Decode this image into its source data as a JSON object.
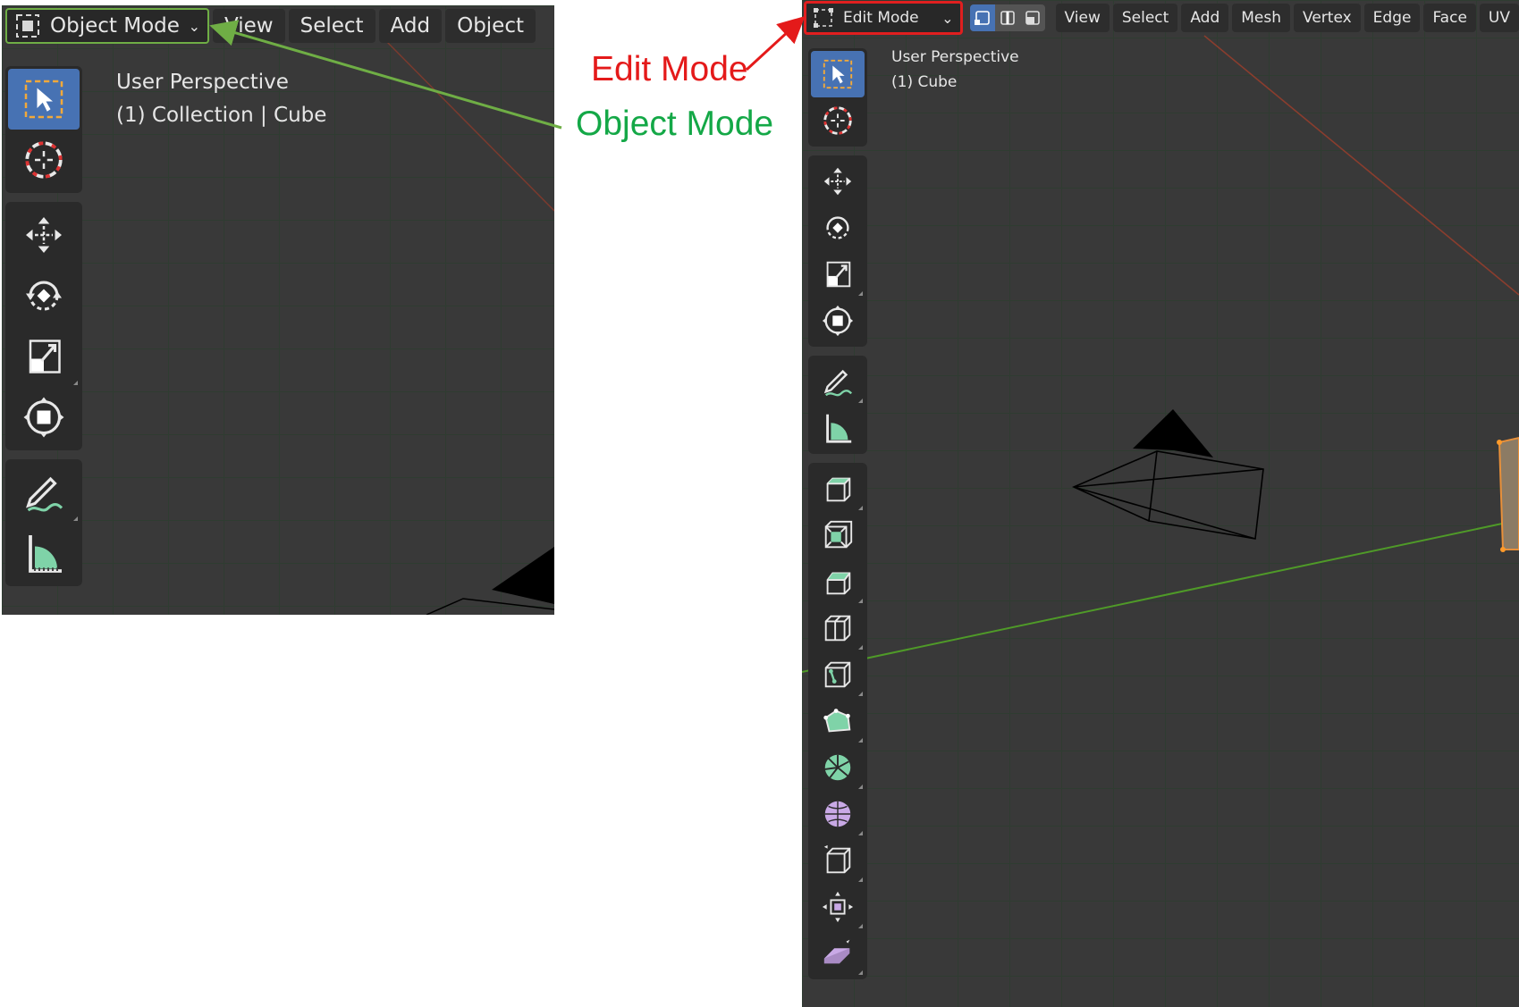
{
  "object_panel": {
    "mode_label": "Object Mode",
    "menu": [
      "View",
      "Select",
      "Add",
      "Object"
    ],
    "overlay": {
      "line1": "User Perspective",
      "line2": "(1) Collection | Cube"
    },
    "tools": [
      {
        "icon": "select-box-icon"
      },
      {
        "icon": "cursor-icon"
      },
      {
        "icon": "move-icon"
      },
      {
        "icon": "rotate-icon"
      },
      {
        "icon": "scale-icon"
      },
      {
        "icon": "transform-icon"
      },
      {
        "icon": "annotate-icon"
      },
      {
        "icon": "measure-icon"
      }
    ]
  },
  "edit_panel": {
    "mode_label": "Edit Mode",
    "menu": [
      "View",
      "Select",
      "Add",
      "Mesh",
      "Vertex",
      "Edge",
      "Face",
      "UV"
    ],
    "select_modes": [
      "vertex-select-icon",
      "edge-select-icon",
      "face-select-icon"
    ],
    "overlay": {
      "line1": "User Perspective",
      "line2": "(1) Cube"
    },
    "tools": [
      {
        "icon": "select-box-icon"
      },
      {
        "icon": "cursor-icon"
      },
      {
        "icon": "move-icon"
      },
      {
        "icon": "rotate-icon"
      },
      {
        "icon": "scale-icon"
      },
      {
        "icon": "transform-icon"
      },
      {
        "icon": "annotate-icon"
      },
      {
        "icon": "measure-icon"
      },
      {
        "icon": "extrude-region-icon"
      },
      {
        "icon": "inset-faces-icon"
      },
      {
        "icon": "bevel-icon"
      },
      {
        "icon": "loop-cut-icon"
      },
      {
        "icon": "knife-icon"
      },
      {
        "icon": "poly-build-icon"
      },
      {
        "icon": "spin-icon"
      },
      {
        "icon": "smooth-icon"
      },
      {
        "icon": "edge-slide-icon"
      },
      {
        "icon": "shrink-fatten-icon"
      },
      {
        "icon": "shear-icon"
      }
    ]
  },
  "annotations": {
    "edit_mode": "Edit Mode",
    "object_mode": "Object Mode",
    "edit_color": "#e41a1a",
    "object_color": "#14a847"
  }
}
